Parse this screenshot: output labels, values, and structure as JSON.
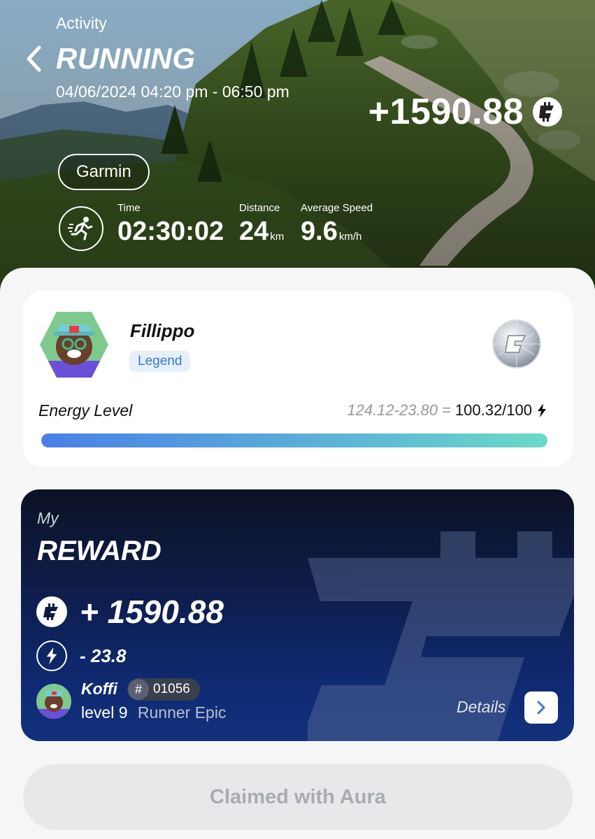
{
  "header": {
    "activity_label": "Activity",
    "title": "RUNNING",
    "date_range": "04/06/2024 04:20 pm - 06:50 pm",
    "reward_amount": "+1590.88",
    "device": "Garmin"
  },
  "stats": {
    "time": {
      "label": "Time",
      "value": "02:30:02"
    },
    "distance": {
      "label": "Distance",
      "value": "24",
      "unit": "km"
    },
    "speed": {
      "label": "Average Speed",
      "value": "9.6",
      "unit": "km/h"
    }
  },
  "profile": {
    "name": "Fillippo",
    "rank": "Legend",
    "energy_label": "Energy Level",
    "energy_formula": "124.12-23.80",
    "energy_equals": "=",
    "energy_result": "100.32/100",
    "energy_fraction": 1.0
  },
  "reward": {
    "subtitle": "My",
    "title": "REWARD",
    "token_amount": "+ 1590.88",
    "energy_cost": "- 23.8",
    "owner_name": "Koffi",
    "token_hash": "#",
    "token_id": "01056",
    "level_word": "level",
    "level_number": "9",
    "level_class": "Runner Epic",
    "details_label": "Details"
  },
  "footer": {
    "claim_label": "Claimed with Aura"
  },
  "colors": {
    "accent_blue": "#3d7bc6",
    "bar_start": "#4a7fe8",
    "bar_end": "#6bd9c9",
    "reward_bg": "#0e1d4a"
  }
}
